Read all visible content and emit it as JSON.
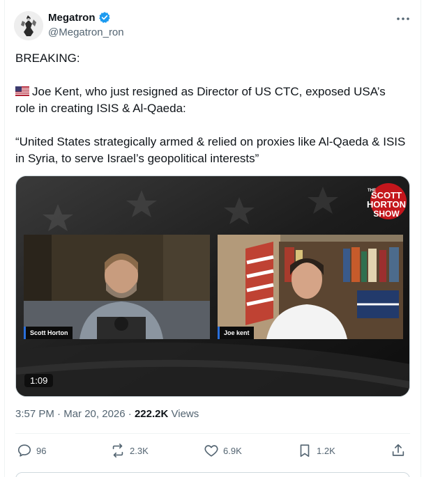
{
  "author": {
    "display_name": "Megatron",
    "handle": "@Megatron_ron",
    "verified": true,
    "avatar_icon": "robot-avatar-icon"
  },
  "tweet": {
    "line1": "BREAKING:",
    "line2_flag": "us-flag-icon",
    "line2": "Joe Kent, who just resigned as Director of US CTC, exposed USA’s role in creating ISIS & Al-Qaeda:",
    "line3": "“United States strategically armed & relied on proxies like Al-Qaeda & ISIS in Syria, to serve Israel’s geopolitical interests”"
  },
  "media": {
    "left_name": "Scott Horton",
    "right_name": "Joe kent",
    "duration": "1:09",
    "logo_line1": "THE",
    "logo_line2": "SCOTT",
    "logo_line3": "HORTON",
    "logo_line4": "SHOW"
  },
  "meta": {
    "time": "3:57 PM",
    "separator": "·",
    "date": "Mar 20, 2026",
    "views_count": "222.2K",
    "views_label": "Views"
  },
  "actions": {
    "replies": "96",
    "reposts": "2.3K",
    "likes": "6.9K",
    "bookmarks": "1.2K"
  },
  "colors": {
    "text": "#0f1419",
    "secondary": "#536471",
    "verified": "#1d9bf0",
    "divider": "#eff3f4"
  }
}
